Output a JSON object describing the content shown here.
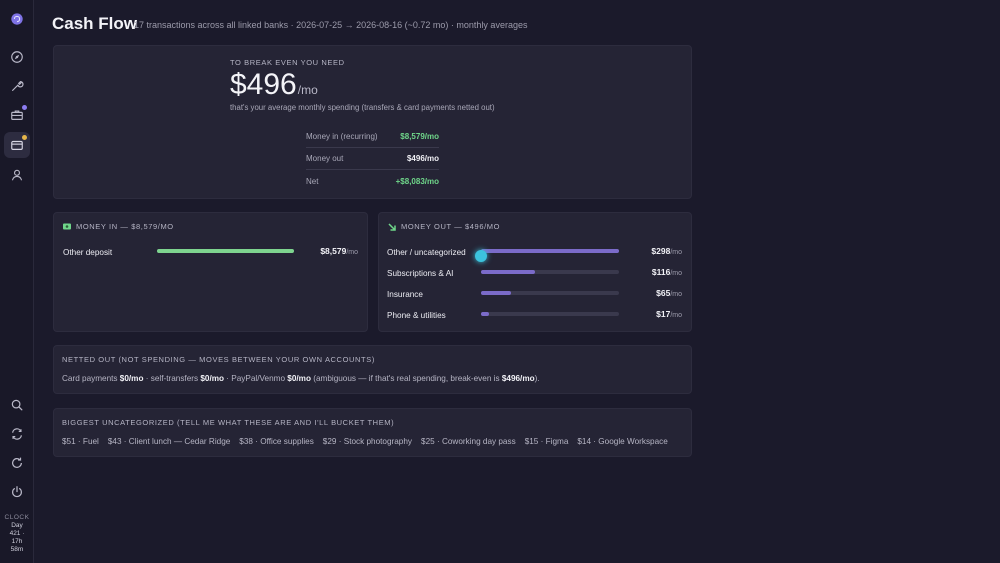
{
  "header": {
    "title": "Cash Flow",
    "subtitle": "17 transactions across all linked banks · 2026-07-25 → 2026-08-16 (~0.72 mo) · monthly averages"
  },
  "sidebar": {
    "items": [
      {
        "name": "brain-icon"
      },
      {
        "name": "compass-icon"
      },
      {
        "name": "wrench-icon"
      },
      {
        "name": "toolbox-icon"
      },
      {
        "name": "wallet-icon"
      },
      {
        "name": "user-icon"
      }
    ],
    "bottom": [
      {
        "name": "search-icon"
      },
      {
        "name": "sync-icon"
      },
      {
        "name": "refresh-icon"
      },
      {
        "name": "power-icon"
      }
    ],
    "clock_label": "CLOCK",
    "clock_lines": [
      "Day",
      "421 ·",
      "17h",
      "58m"
    ]
  },
  "breakeven": {
    "label": "TO BREAK EVEN YOU NEED",
    "amount": "$496",
    "unit": "/mo",
    "note": "that's your average monthly spending (transfers & card payments netted out)",
    "rows": [
      {
        "label": "Money in (recurring)",
        "value": "$8,579/mo"
      },
      {
        "label": "Money out",
        "value": "$496/mo"
      },
      {
        "label": "Net",
        "value": "+$8,083/mo"
      }
    ]
  },
  "money_in": {
    "heading": "MONEY IN — $8,579/MO",
    "items": [
      {
        "name": "Other deposit",
        "amount": "$8,579",
        "unit": "/mo",
        "fraction": 1.0
      }
    ]
  },
  "money_out": {
    "heading": "MONEY OUT — $496/MO",
    "items": [
      {
        "name": "Other / uncategorized",
        "amount": "$298",
        "unit": "/mo",
        "fraction": 1.0
      },
      {
        "name": "Subscriptions & AI",
        "amount": "$116",
        "unit": "/mo",
        "fraction": 0.39
      },
      {
        "name": "Insurance",
        "amount": "$65",
        "unit": "/mo",
        "fraction": 0.22
      },
      {
        "name": "Phone & utilities",
        "amount": "$17",
        "unit": "/mo",
        "fraction": 0.06
      }
    ]
  },
  "netted": {
    "heading": "NETTED OUT (NOT SPENDING — MOVES BETWEEN YOUR OWN ACCOUNTS)",
    "parts": [
      "Card payments ",
      "$0/mo",
      " · self-transfers ",
      "$0/mo",
      " · PayPal/Venmo ",
      "$0/mo",
      " (ambiguous — if that's real spending, break-even is ",
      "$496/mo",
      ")."
    ]
  },
  "uncategorized": {
    "heading": "BIGGEST UNCATEGORIZED (TELL ME WHAT THESE ARE AND I'LL BUCKET THEM)",
    "items": [
      "$51 · Fuel",
      "$43 · Client lunch — Cedar Ridge",
      "$38 · Office supplies",
      "$29 · Stock photography",
      "$25 · Coworking day pass",
      "$15 · Figma",
      "$14 · Google Workspace"
    ]
  },
  "colors": {
    "in_bar": "#7ed48f",
    "out_bar": "#7b6bc9",
    "green_text": "#6fd68a",
    "badge_purple": "#8c7cf0",
    "badge_amber": "#e5b54a",
    "cursor": "#3cc3dd"
  }
}
